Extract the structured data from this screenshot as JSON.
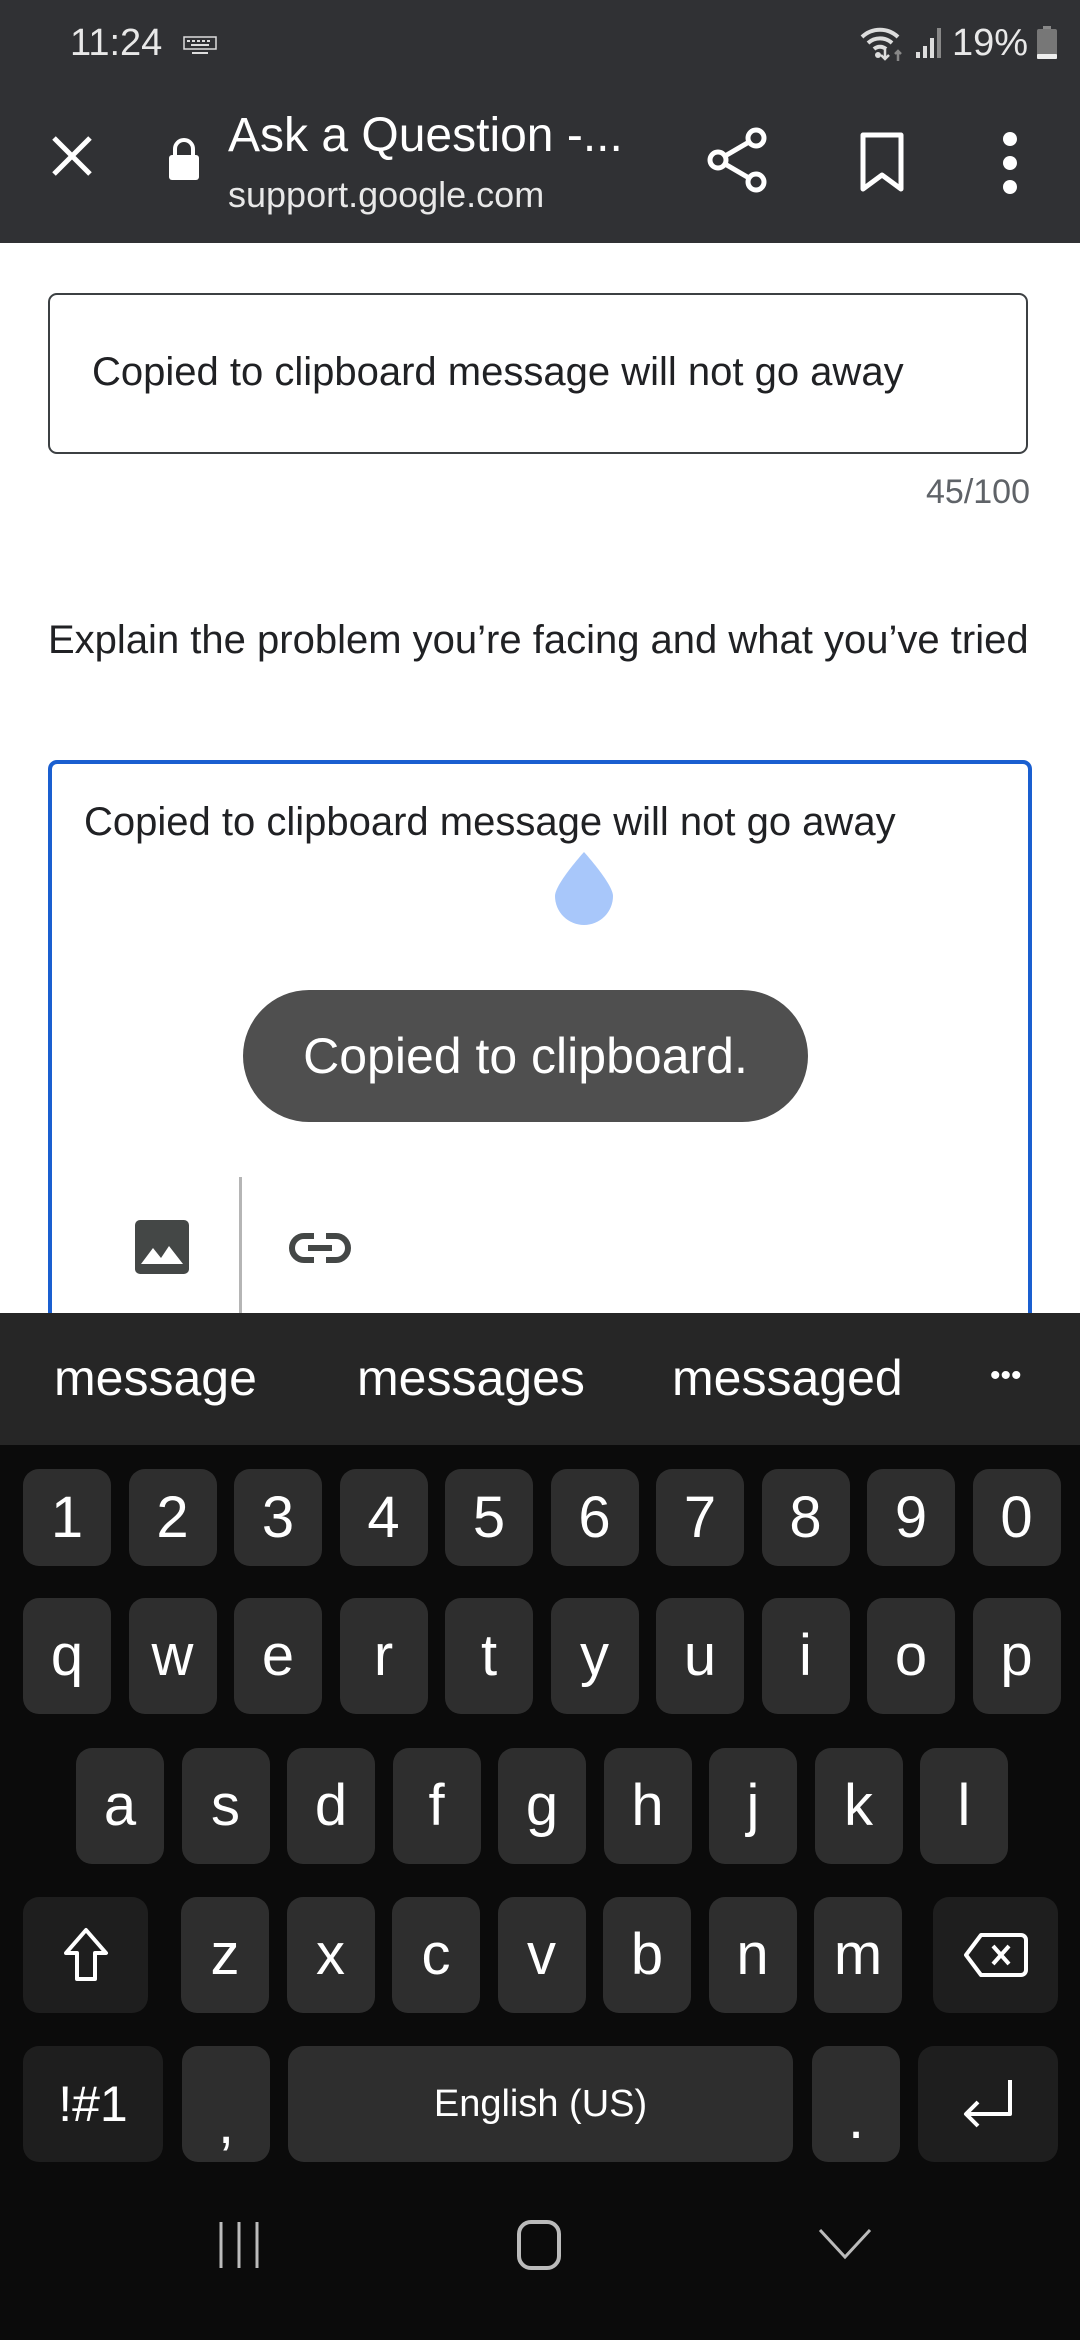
{
  "status_bar": {
    "time": "11:24",
    "battery": "19%",
    "icons": [
      "keyboard-icon",
      "wifi-icon",
      "signal-icon",
      "battery-icon"
    ]
  },
  "browser": {
    "title": "Ask a Question -...",
    "url": "support.google.com",
    "close_icon": "close-icon",
    "lock_icon": "lock-icon",
    "share_icon": "share-icon",
    "bookmark_icon": "bookmark-icon",
    "menu_icon": "more-vert-icon"
  },
  "form": {
    "title_field": {
      "value": "Copied to clipboard message will not go away",
      "counter": "45/100"
    },
    "description": {
      "label": "Explain the problem you’re facing and what you’ve tried",
      "value": "Copied to clipboard message will not go away",
      "toolbar": [
        "image-icon",
        "link-icon"
      ]
    }
  },
  "toast": {
    "message": "Copied to clipboard."
  },
  "keyboard": {
    "suggestions": [
      "message",
      "messages",
      "messaged",
      "•••"
    ],
    "rows": [
      [
        "1",
        "2",
        "3",
        "4",
        "5",
        "6",
        "7",
        "8",
        "9",
        "0"
      ],
      [
        "q",
        "w",
        "e",
        "r",
        "t",
        "y",
        "u",
        "i",
        "o",
        "p"
      ],
      [
        "a",
        "s",
        "d",
        "f",
        "g",
        "h",
        "j",
        "k",
        "l"
      ],
      [
        "z",
        "x",
        "c",
        "v",
        "b",
        "n",
        "m"
      ]
    ],
    "symbols_key": "!#1",
    "comma_key": ",",
    "space_key": "English (US)",
    "period_key": ".",
    "shift_icon": "shift-icon",
    "backspace_icon": "backspace-icon",
    "enter_icon": "enter-icon"
  },
  "nav_bar": {
    "recents_icon": "recents-icon",
    "home_icon": "home-icon",
    "back_icon": "hide-keyboard-icon"
  }
}
